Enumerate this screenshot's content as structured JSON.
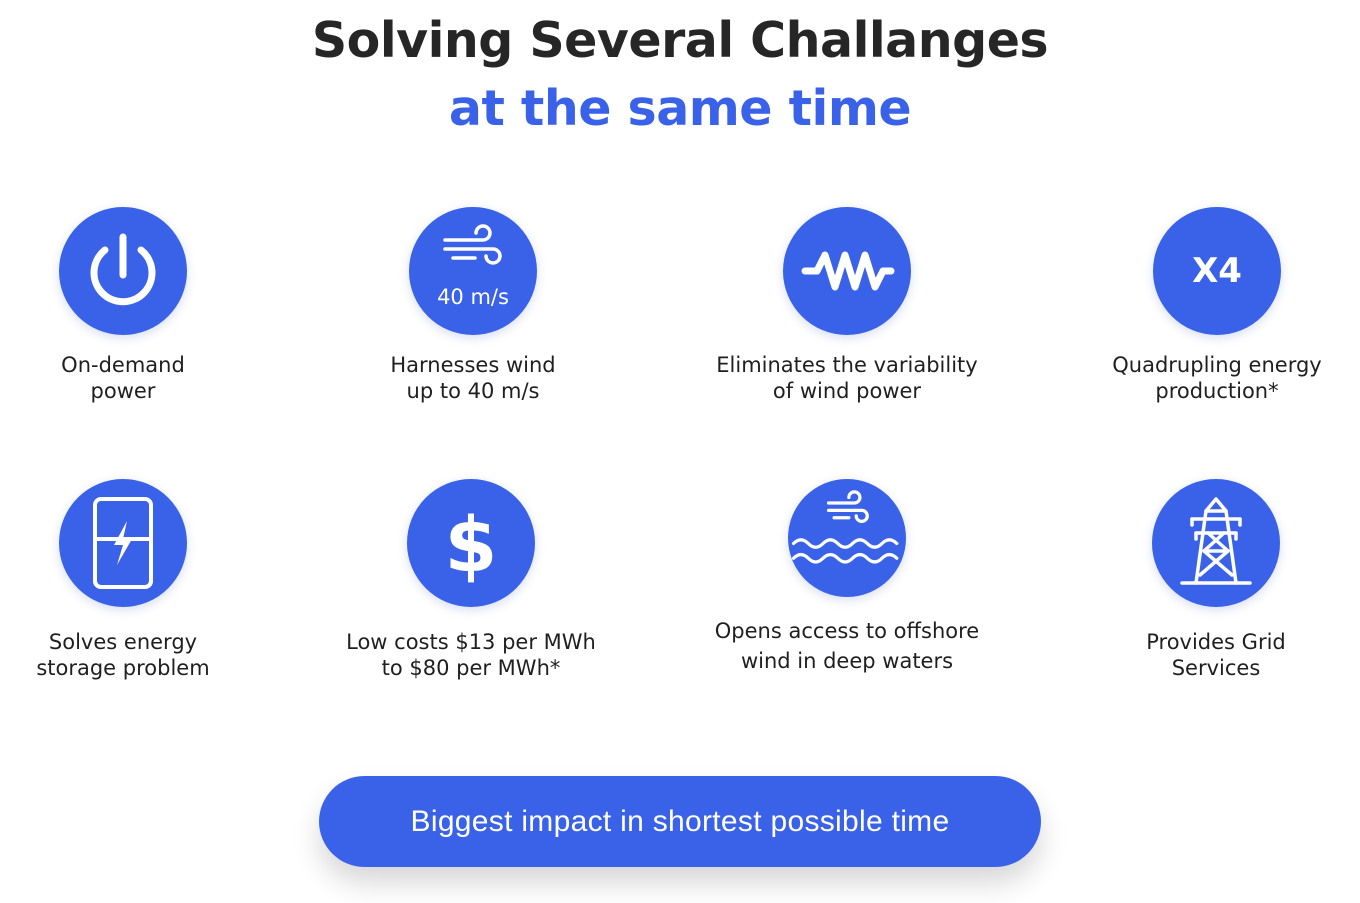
{
  "heading": {
    "line1": "Solving Several Challanges",
    "line2": "at the same time"
  },
  "colors": {
    "accent": "#3a62e8",
    "text": "#1f1f1f",
    "title": "#262626"
  },
  "features": [
    {
      "icon": "power-icon",
      "line1": "On-demand",
      "line2": "power"
    },
    {
      "icon": "wind-speed-icon",
      "icon_text": "40 m/s",
      "line1": "Harnesses wind",
      "line2": "up to 40 m/s"
    },
    {
      "icon": "zigzag-wave-icon",
      "line1": "Eliminates the variability",
      "line2": "of wind power"
    },
    {
      "icon": "x4-icon",
      "icon_text": "X4",
      "line1": "Quadrupling energy",
      "line2": "production*"
    },
    {
      "icon": "battery-bolt-icon",
      "line1": "Solves energy",
      "line2": "storage problem"
    },
    {
      "icon": "dollar-icon",
      "line1": "Low costs $13 per MWh",
      "line2": "to $80 per MWh*"
    },
    {
      "icon": "offshore-wind-waves-icon",
      "line1": "Opens access to offshore",
      "line2": "wind in deep waters"
    },
    {
      "icon": "transmission-tower-icon",
      "line1": "Provides Grid",
      "line2": "Services"
    }
  ],
  "cta": {
    "label": "Biggest impact in shortest possible time"
  }
}
